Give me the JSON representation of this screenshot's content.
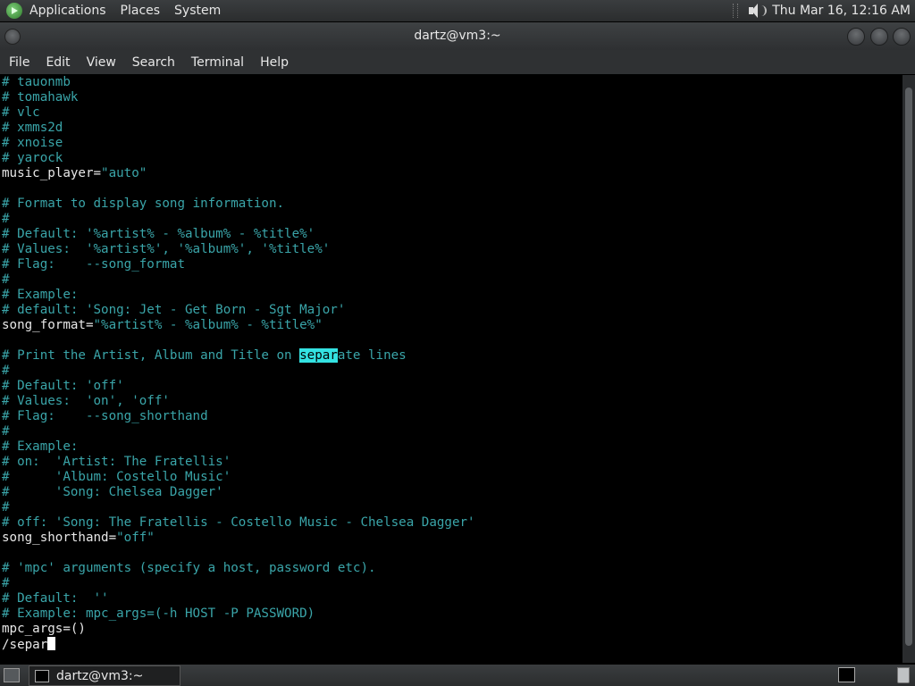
{
  "top_panel": {
    "menus": [
      "Applications",
      "Places",
      "System"
    ],
    "clock": "Thu Mar 16, 12:16 AM"
  },
  "window": {
    "title": "dartz@vm3:~"
  },
  "menubar": {
    "items": [
      "File",
      "Edit",
      "View",
      "Search",
      "Terminal",
      "Help"
    ]
  },
  "terminal": {
    "lines": [
      [
        {
          "t": "# tauonmb",
          "k": "c"
        }
      ],
      [
        {
          "t": "# tomahawk",
          "k": "c"
        }
      ],
      [
        {
          "t": "# vlc",
          "k": "c"
        }
      ],
      [
        {
          "t": "# xmms2d",
          "k": "c"
        }
      ],
      [
        {
          "t": "# xnoise",
          "k": "c"
        }
      ],
      [
        {
          "t": "# yarock",
          "k": "c"
        }
      ],
      [
        {
          "t": "music_player=",
          "k": "w"
        },
        {
          "t": "\"auto\"",
          "k": "s"
        }
      ],
      [
        {
          "t": "",
          "k": "w"
        }
      ],
      [
        {
          "t": "# Format to display song information.",
          "k": "c"
        }
      ],
      [
        {
          "t": "#",
          "k": "c"
        }
      ],
      [
        {
          "t": "# Default: '%artist% - %album% - %title%'",
          "k": "c"
        }
      ],
      [
        {
          "t": "# Values:  '%artist%', '%album%', '%title%'",
          "k": "c"
        }
      ],
      [
        {
          "t": "# Flag:    --song_format",
          "k": "c"
        }
      ],
      [
        {
          "t": "#",
          "k": "c"
        }
      ],
      [
        {
          "t": "# Example:",
          "k": "c"
        }
      ],
      [
        {
          "t": "# default: 'Song: Jet - Get Born - Sgt Major'",
          "k": "c"
        }
      ],
      [
        {
          "t": "song_format=",
          "k": "w"
        },
        {
          "t": "\"%artist% - %album% - %title%\"",
          "k": "s"
        }
      ],
      [
        {
          "t": "",
          "k": "w"
        }
      ],
      [
        {
          "t": "# Print the Artist, Album and Title on ",
          "k": "c"
        },
        {
          "t": "separ",
          "k": "hl"
        },
        {
          "t": "ate lines",
          "k": "c"
        }
      ],
      [
        {
          "t": "#",
          "k": "c"
        }
      ],
      [
        {
          "t": "# Default: 'off'",
          "k": "c"
        }
      ],
      [
        {
          "t": "# Values:  'on', 'off'",
          "k": "c"
        }
      ],
      [
        {
          "t": "# Flag:    --song_shorthand",
          "k": "c"
        }
      ],
      [
        {
          "t": "#",
          "k": "c"
        }
      ],
      [
        {
          "t": "# Example:",
          "k": "c"
        }
      ],
      [
        {
          "t": "# on:  'Artist: The Fratellis'",
          "k": "c"
        }
      ],
      [
        {
          "t": "#      'Album: Costello Music'",
          "k": "c"
        }
      ],
      [
        {
          "t": "#      'Song: Chelsea Dagger'",
          "k": "c"
        }
      ],
      [
        {
          "t": "#",
          "k": "c"
        }
      ],
      [
        {
          "t": "# off: 'Song: The Fratellis - Costello Music - Chelsea Dagger'",
          "k": "c"
        }
      ],
      [
        {
          "t": "song_shorthand=",
          "k": "w"
        },
        {
          "t": "\"off\"",
          "k": "s"
        }
      ],
      [
        {
          "t": "",
          "k": "w"
        }
      ],
      [
        {
          "t": "# 'mpc' arguments (specify a host, password etc).",
          "k": "c"
        }
      ],
      [
        {
          "t": "#",
          "k": "c"
        }
      ],
      [
        {
          "t": "# Default:  ''",
          "k": "c"
        }
      ],
      [
        {
          "t": "# Example: mpc_args=(-h HOST -P PASSWORD)",
          "k": "c"
        }
      ],
      [
        {
          "t": "mpc_args=()",
          "k": "w"
        }
      ],
      [
        {
          "t": "/separ",
          "k": "w"
        },
        {
          "t": "",
          "k": "cursor"
        }
      ]
    ]
  },
  "taskbar": {
    "task_label": "dartz@vm3:~"
  }
}
